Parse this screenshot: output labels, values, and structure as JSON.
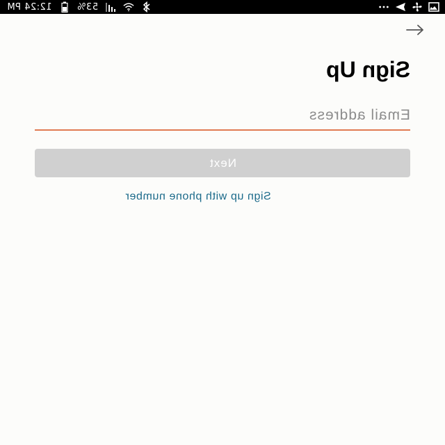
{
  "status_bar": {
    "time": "12:24 PM",
    "battery_percent": "53%",
    "icons": [
      "image-icon",
      "fan-icon",
      "send-icon",
      "more-dots-icon",
      "bluetooth-icon",
      "wifi-icon",
      "signal-icon",
      "battery-icon"
    ]
  },
  "header": {
    "back_icon": "arrow-icon"
  },
  "form": {
    "title": "Sign Up",
    "email_placeholder": "Email address",
    "email_value": "",
    "next_label": "Next",
    "phone_link_label": "Sign up with phone number"
  },
  "colors": {
    "accent_underline": "#e07a52",
    "link": "#1b6a8a",
    "button_disabled": "#d0d0d0",
    "status_bar": "#000000"
  }
}
